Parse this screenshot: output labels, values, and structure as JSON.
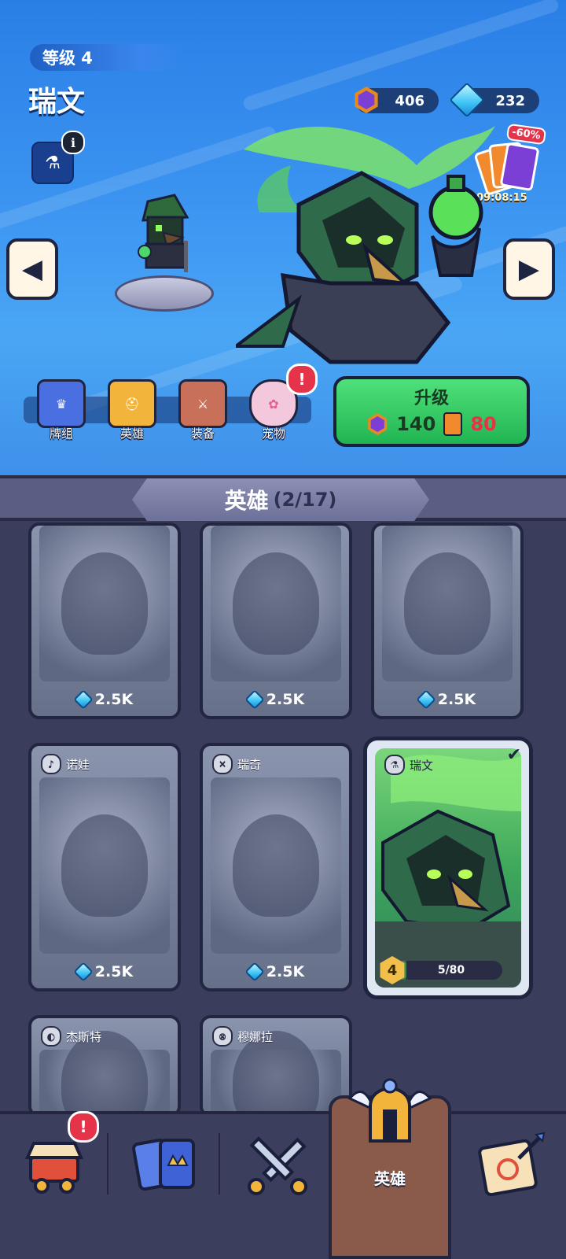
{
  "header": {
    "level_label": "等级 4",
    "hero_name": "瑞文",
    "info_icon": "info-icon"
  },
  "currencies": {
    "hex_coin": "406",
    "gems": "232"
  },
  "offer": {
    "discount": "-60%",
    "timer": "09:08:15"
  },
  "tabs": [
    {
      "label": "牌组",
      "icon": "deck-icon"
    },
    {
      "label": "英雄",
      "icon": "helmet-icon"
    },
    {
      "label": "装备",
      "icon": "equipment-icon"
    },
    {
      "label": "宠物",
      "icon": "paw-icon",
      "alert": "!"
    }
  ],
  "upgrade": {
    "label": "升级",
    "coin_cost": "140",
    "card_cost": "80"
  },
  "panel": {
    "title": "英雄",
    "count": "(2/17)"
  },
  "cards": [
    {
      "name": "",
      "price": "2.5K",
      "locked": true
    },
    {
      "name": "",
      "price": "2.5K",
      "locked": true
    },
    {
      "name": "",
      "price": "2.5K",
      "locked": true
    },
    {
      "name": "诺娃",
      "price": "2.5K",
      "locked": true
    },
    {
      "name": "瑞奇",
      "price": "2.5K",
      "locked": true
    },
    {
      "name": "杰斯特",
      "price": "",
      "locked": true
    },
    {
      "name": "穆娜拉",
      "price": "",
      "locked": true
    }
  ],
  "selected_card": {
    "name": "瑞文",
    "level": "4",
    "progress": "5/80",
    "progress_fraction": 0.0625
  },
  "bottom_nav": {
    "shop_alert": "!",
    "active_label": "英雄"
  }
}
